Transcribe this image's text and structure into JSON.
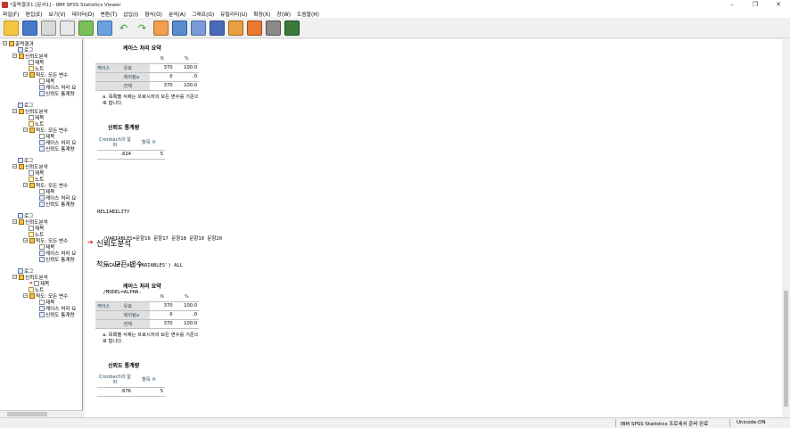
{
  "window": {
    "title": "*출력결과1 [문서1] - IBM SPSS Statistics Viewer",
    "controls": {
      "minimize": "–",
      "maximize": "❐",
      "close": "✕"
    }
  },
  "menu": [
    "파일(F)",
    "편집(E)",
    "보기(V)",
    "데이터(D)",
    "변환(T)",
    "삽입(I)",
    "형식(O)",
    "분석(A)",
    "그래프(G)",
    "유틸리티(U)",
    "확장(X)",
    "창(W)",
    "도움말(H)"
  ],
  "toolbar": [
    "open-icon",
    "save-icon",
    "print-icon",
    "print-preview-icon",
    "export-icon",
    "recall-dialog-icon",
    "undo-icon",
    "redo-icon",
    "goto-data-icon",
    "goto-case-icon",
    "goto-variable-icon",
    "variables-icon",
    "designate-window-icon",
    "select-output-icon",
    "hide-icon",
    "promote-icon"
  ],
  "nav": {
    "root": "출력결과",
    "log": "로그",
    "reliability": "신뢰도분석",
    "title": "제목",
    "notes": "노트",
    "scale": "척도: 모든 변수",
    "scale_short": "척도: 모든 변수",
    "case_summary": "케이스 처리 요",
    "rel_stats": "신뢰도 통계량"
  },
  "content": {
    "table1": {
      "title": "케이스 처리 요약",
      "col_n": "N",
      "col_pct": "%",
      "row_group": "케이스",
      "rows": [
        {
          "label": "유효",
          "n": "370",
          "pct": "100.0"
        },
        {
          "label": "제외됨a",
          "n": "0",
          "pct": ".0"
        },
        {
          "label": "전체",
          "n": "370",
          "pct": "100.0"
        }
      ],
      "footnote": "a. 목록별 삭제는 프로시저의 모든 변수를 기준으로 합니다."
    },
    "table2": {
      "title": "신뢰도 통계량",
      "col1": "Cronbach의 알파",
      "col2": "항목 수",
      "alpha": ".624",
      "items": "5"
    },
    "syntax": [
      "RELIABILITY",
      "  /VARIABLES=문항16 문항17 문항18 문항19 문항20",
      "  /SCALE('ALL VARIABLES') ALL",
      "  /MODEL=ALPHA."
    ],
    "section_heading": "신뢰도분석",
    "scale_heading": "척도: 모든 변수",
    "table3": {
      "title": "케이스 처리 요약",
      "col_n": "N",
      "col_pct": "%",
      "row_group": "케이스",
      "rows": [
        {
          "label": "유효",
          "n": "370",
          "pct": "100.0"
        },
        {
          "label": "제외됨a",
          "n": "0",
          "pct": ".0"
        },
        {
          "label": "전체",
          "n": "370",
          "pct": "100.0"
        }
      ],
      "footnote": "a. 목록별 삭제는 프로시저의 모든 변수를 기준으로 합니다."
    },
    "table4": {
      "title": "신뢰도 통계량",
      "col1": "Cronbach의 알파",
      "col2": "항목 수",
      "alpha": ".676",
      "items": "5"
    }
  },
  "status": {
    "message": "IBM SPSS Statistics 프로세서 준비 완료",
    "unicode": "Unicode:ON"
  },
  "colors": {
    "accent": "#264a60",
    "arrow": "#e02020"
  }
}
